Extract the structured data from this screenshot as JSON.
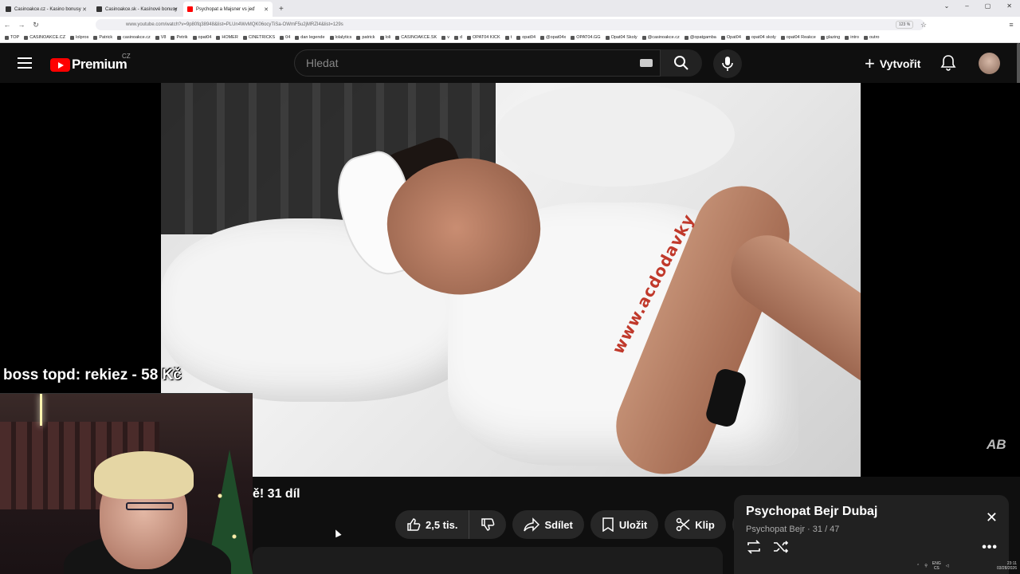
{
  "browser": {
    "tabs": [
      {
        "title": "Casinoakce.cz - Kasino bonusy",
        "active": false
      },
      {
        "title": "Casinoakce.sk - Kasínové bonusy",
        "active": false
      },
      {
        "title": "Psychopat a Majsner vs jeď",
        "active": true
      }
    ],
    "new_tab_icon": "plus-icon",
    "url": "www.youtube.com/watch?v=9p80fq38948&list=PLUn4WvMQK06ocyTiSa-OWmF5u2jMRZI4&list=129s",
    "zoom": "123 %",
    "bookmarks": [
      "TOP",
      "CASINOAKCE.CZ",
      "lolpros",
      "Patrick",
      "casinoakce.cz",
      "V8",
      "Petrik",
      "opat04",
      "HOMER",
      "CINETRICKS",
      "04",
      "dan legende",
      "lolalytics",
      "patrick",
      "loli",
      "CASINOAKCE.SK",
      "v",
      "d",
      "OPAT04 KICK",
      "t",
      "opat04",
      "@opat04x",
      "OPAT04.GG",
      "Opat04 Skoly",
      "@casinoakce.cz",
      "@opatgamba",
      "Opat04",
      "opat04 skoly",
      "opat04 Reakce",
      "glazing",
      "intro",
      "outro"
    ]
  },
  "youtube": {
    "logo_text": "Premium",
    "region": "CZ",
    "search_placeholder": "Hledat",
    "create_label": "Vytvořit",
    "icons": {
      "menu": "hamburger-icon",
      "search": "search-icon",
      "mic": "mic-icon",
      "bell": "bell-icon",
      "keyboard": "keyboard-icon"
    }
  },
  "overlay": {
    "donation": "boss topd:  rekiez - 58 Kč",
    "watermark": "AB"
  },
  "video": {
    "title_fragment": "ě! 31 díl",
    "like_count": "2,5 tis.",
    "share_label": "Sdílet",
    "save_label": "Uložit",
    "clip_label": "Klip",
    "shirt_text": "www.acdodavky"
  },
  "miniplayer": {
    "title": "Psychopat Bejr  Dubaj",
    "channel": "Psychopat Bejr",
    "position": "31 / 47"
  },
  "taskbar": {
    "lang_top": "ENG",
    "lang_bottom": "CS",
    "time": "23:11",
    "date": "03/28/2026"
  },
  "colors": {
    "brand": "#ff0000",
    "background": "#0f0f0f",
    "pill": "#272727"
  }
}
